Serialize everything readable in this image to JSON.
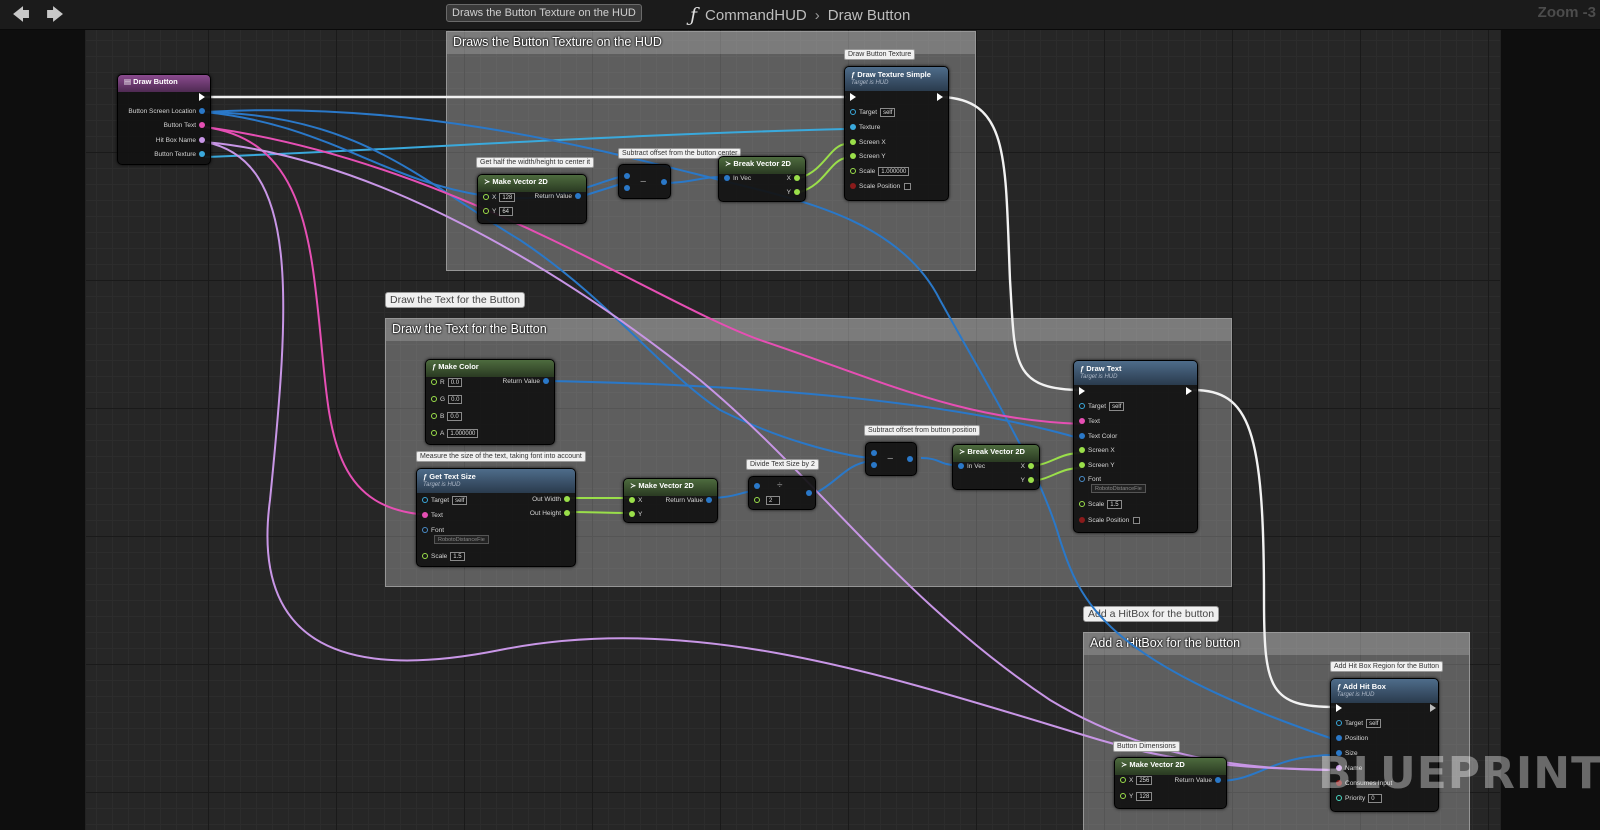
{
  "toolbar": {
    "back_icon": "arrow-left-icon",
    "forward_icon": "arrow-right-icon"
  },
  "tooltip": "Draws the Button Texture on the HUD",
  "breadcrumb": {
    "icon": "ƒ",
    "graph": "CommandHUD",
    "separator": "›",
    "function": "Draw Button"
  },
  "zoom": "Zoom -3",
  "watermark": "BLUEPRINT",
  "colors": {
    "exec": "#ffffff",
    "vector": "#2a78c8",
    "text": "#e64fb4",
    "float": "#9adf4a",
    "name": "#c896e6",
    "texture": "#3aa9dc",
    "font": "#4a8cc8"
  },
  "comments": [
    {
      "title": "Draws the Button Texture on the HUD"
    },
    {
      "title": "Draw the Text for the Button",
      "bubble": "Draw the Text for the Button"
    },
    {
      "title": "Add a HitBox for the button",
      "bubble": "Add a HitBox for the button"
    }
  ],
  "nodes": {
    "draw_button": {
      "title": "Draw Button",
      "pins": [
        "Button Screen Location",
        "Button Text",
        "Hit Box Name",
        "Button Texture"
      ]
    },
    "make_vec_a": {
      "note": "Get half the width/height to center it",
      "title": "Make Vector 2D",
      "x_label": "X",
      "x": "128",
      "y_label": "Y",
      "y": "64",
      "out": "Return Value"
    },
    "subtract_a": {
      "note": "Subtract offset from the button center",
      "glyph": "−"
    },
    "break_a": {
      "title": "Break Vector 2D",
      "in": "In Vec",
      "x": "X",
      "y": "Y"
    },
    "draw_texture": {
      "note": "Draw Button Texture",
      "title": "Draw Texture Simple",
      "sub": "Target is HUD",
      "target": "Target",
      "self": "self",
      "texture": "Texture",
      "sx": "Screen X",
      "sy": "Screen Y",
      "scale": "Scale",
      "scale_val": "1.000000",
      "scale_pos": "Scale Position"
    },
    "make_color": {
      "title": "Make Color",
      "r": "R",
      "r_val": "0.0",
      "g": "G",
      "g_val": "0.0",
      "b": "B",
      "b_val": "0.0",
      "a": "A",
      "a_val": "1.000000",
      "out": "Return Value"
    },
    "get_text_size": {
      "note": "Measure the size of the text, taking font into account",
      "title": "Get Text Size",
      "sub": "Target is HUD",
      "target": "Target",
      "self": "self",
      "text": "Text",
      "font": "Font",
      "font_val": "RobotoDistanceFie",
      "scale": "Scale",
      "scale_val": "1.5",
      "out_w": "Out Width",
      "out_h": "Out Height"
    },
    "make_vec_b": {
      "title": "Make Vector 2D",
      "x": "X",
      "y": "Y",
      "out": "Return Value"
    },
    "divide": {
      "note": "Divide Text Size by 2",
      "glyph": "÷",
      "val": "2"
    },
    "subtract_b": {
      "note": "Subtract offset from button position",
      "glyph": "−"
    },
    "break_b": {
      "title": "Break Vector 2D",
      "in": "In Vec",
      "x": "X",
      "y": "Y"
    },
    "draw_text": {
      "title": "Draw Text",
      "sub": "Target is HUD",
      "target": "Target",
      "self": "self",
      "text": "Text",
      "color": "Text Color",
      "sx": "Screen X",
      "sy": "Screen Y",
      "font": "Font",
      "font_val": "RobotoDistanceFie",
      "scale": "Scale",
      "scale_val": "1.5",
      "scale_pos": "Scale Position"
    },
    "make_vec_c": {
      "note": "Button Dimensions",
      "title": "Make Vector 2D",
      "x": "X",
      "x_val": "256",
      "y": "Y",
      "y_val": "128",
      "out": "Return Value"
    },
    "add_hitbox": {
      "note": "Add Hit Box Region for the Button",
      "title": "Add Hit Box",
      "sub": "Target is HUD",
      "target": "Target",
      "self": "self",
      "position": "Position",
      "size": "Size",
      "name": "Name",
      "consumes": "Consumes Input",
      "priority": "Priority",
      "priority_val": "0"
    }
  }
}
